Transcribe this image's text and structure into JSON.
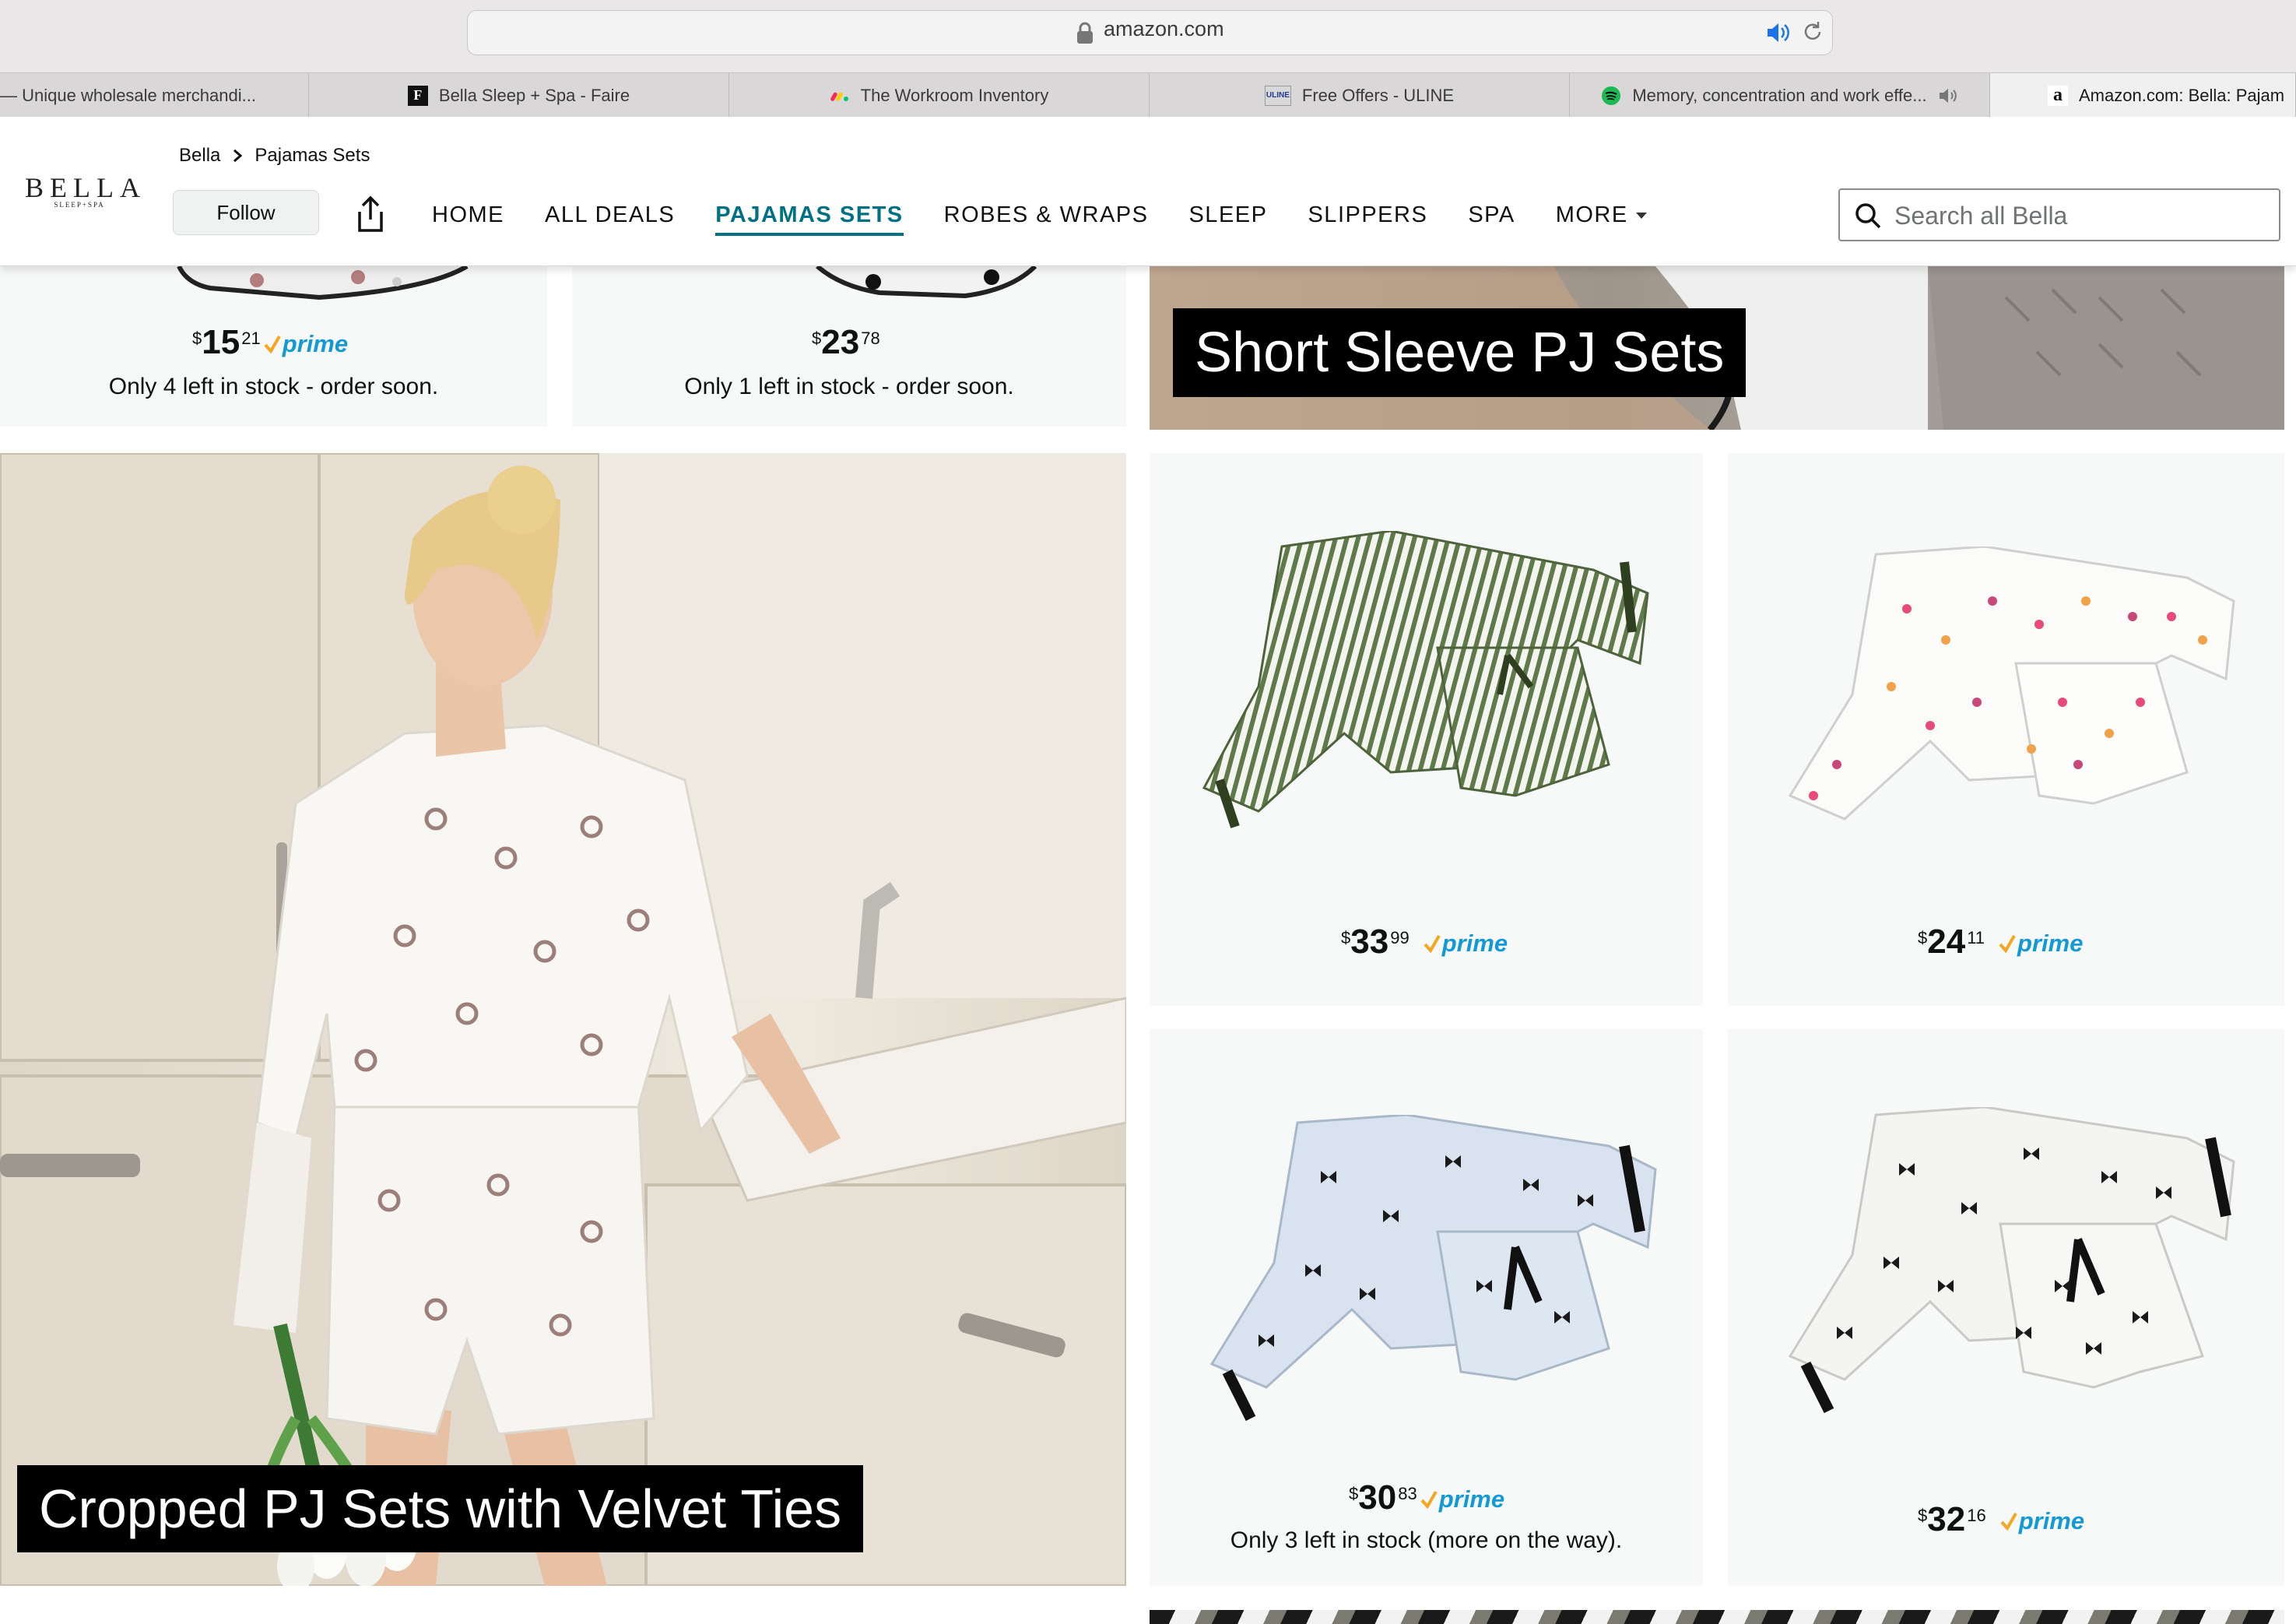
{
  "browser": {
    "url": "amazon.com",
    "tabs": [
      {
        "label": "— Unique wholesale merchandi...",
        "favicon": "none",
        "active": false
      },
      {
        "label": "Bella Sleep + Spa - Faire",
        "favicon": "F",
        "active": false
      },
      {
        "label": "The Workroom Inventory",
        "favicon": "monday-icon",
        "active": false
      },
      {
        "label": "Free Offers - ULINE",
        "favicon": "ULINE",
        "active": false
      },
      {
        "label": "Memory, concentration and work effe...",
        "favicon": "spotify-icon",
        "active": false
      },
      {
        "label": "Amazon.com: Bella: Pajam",
        "favicon": "a",
        "active": true
      }
    ]
  },
  "store": {
    "logo_text": "BELLA",
    "logo_sub": "SLEEP+SPA",
    "breadcrumb": [
      "Bella",
      "Pajamas Sets"
    ],
    "follow_label": "Follow",
    "nav": [
      {
        "label": "HOME",
        "active": false
      },
      {
        "label": "ALL DEALS",
        "active": false
      },
      {
        "label": "PAJAMAS SETS",
        "active": true
      },
      {
        "label": "ROBES & WRAPS",
        "active": false
      },
      {
        "label": "SLEEP",
        "active": false
      },
      {
        "label": "SLIPPERS",
        "active": false
      },
      {
        "label": "SPA",
        "active": false
      },
      {
        "label": "MORE",
        "active": false,
        "dropdown": true
      }
    ],
    "search_placeholder": "Search all Bella"
  },
  "content": {
    "top_products": [
      {
        "currency": "$",
        "whole": "15",
        "fraction": "21",
        "prime": "prime",
        "stock": "Only 4 left in stock - order soon."
      },
      {
        "currency": "$",
        "whole": "23",
        "fraction": "78",
        "prime": "",
        "stock": "Only 1 left in stock - order soon."
      }
    ],
    "banner_short_sleeve": "Short Sleeve PJ Sets",
    "banner_cropped": "Cropped PJ Sets with Velvet Ties",
    "products": [
      {
        "name": "green-stripe-pj-set",
        "currency": "$",
        "whole": "33",
        "fraction": "99",
        "prime": "prime",
        "stock": ""
      },
      {
        "name": "polka-dot-pj-set",
        "currency": "$",
        "whole": "24",
        "fraction": "11",
        "prime": "prime",
        "stock": ""
      },
      {
        "name": "blue-bow-pj-set",
        "currency": "$",
        "whole": "30",
        "fraction": "83",
        "prime": "prime",
        "stock": "Only 3 left in stock (more on the way)."
      },
      {
        "name": "white-bow-pj-set",
        "currency": "$",
        "whole": "32",
        "fraction": "16",
        "prime": "prime",
        "stock": ""
      }
    ]
  },
  "colors": {
    "accent_teal": "#007185",
    "prime_blue": "#1399d6",
    "prime_check": "#f5a623"
  }
}
